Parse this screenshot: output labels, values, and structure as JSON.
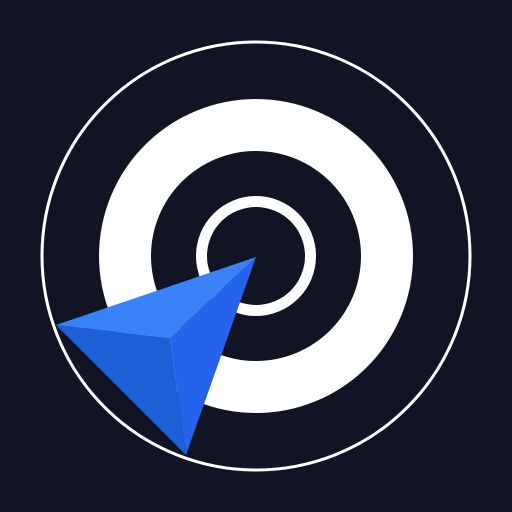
{
  "icon": {
    "name": "target-navigation-icon",
    "colors": {
      "background": "#111424",
      "ring_outline": "#ffffff",
      "target": "#ffffff",
      "arrow_light": "#3b82f6",
      "arrow_dark": "#1f5fd6",
      "arrow_shadow": "#2563eb"
    }
  }
}
